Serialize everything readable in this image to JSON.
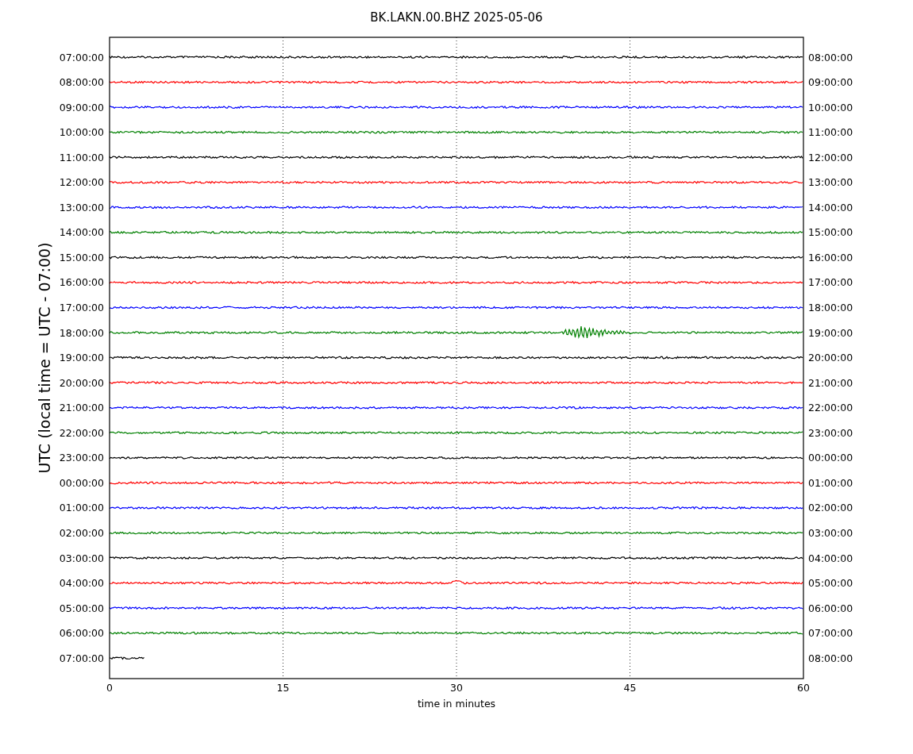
{
  "title": "BK.LAKN.00.BHZ 2025-05-06",
  "y_axis_label": "UTC (local time = UTC - 07:00)",
  "x_axis_label": "time in minutes",
  "x_ticks": [
    "0",
    "15",
    "30",
    "45",
    "60"
  ],
  "traces": [
    {
      "left_label": "07:00:00",
      "right_label": "08:00:00",
      "color": "#000000",
      "kind": "noise"
    },
    {
      "left_label": "08:00:00",
      "right_label": "09:00:00",
      "color": "#ff0000",
      "kind": "noise"
    },
    {
      "left_label": "09:00:00",
      "right_label": "10:00:00",
      "color": "#0000ff",
      "kind": "noise"
    },
    {
      "left_label": "10:00:00",
      "right_label": "11:00:00",
      "color": "#008000",
      "kind": "noise"
    },
    {
      "left_label": "11:00:00",
      "right_label": "12:00:00",
      "color": "#000000",
      "kind": "noise"
    },
    {
      "left_label": "12:00:00",
      "right_label": "13:00:00",
      "color": "#ff0000",
      "kind": "noise"
    },
    {
      "left_label": "13:00:00",
      "right_label": "14:00:00",
      "color": "#0000ff",
      "kind": "noise"
    },
    {
      "left_label": "14:00:00",
      "right_label": "15:00:00",
      "color": "#008000",
      "kind": "noise"
    },
    {
      "left_label": "15:00:00",
      "right_label": "16:00:00",
      "color": "#000000",
      "kind": "noise"
    },
    {
      "left_label": "16:00:00",
      "right_label": "17:00:00",
      "color": "#ff0000",
      "kind": "noise"
    },
    {
      "left_label": "17:00:00",
      "right_label": "18:00:00",
      "color": "#0000ff",
      "kind": "noise"
    },
    {
      "left_label": "18:00:00",
      "right_label": "19:00:00",
      "color": "#008000",
      "kind": "earthquake"
    },
    {
      "left_label": "19:00:00",
      "right_label": "20:00:00",
      "color": "#000000",
      "kind": "noise"
    },
    {
      "left_label": "20:00:00",
      "right_label": "21:00:00",
      "color": "#ff0000",
      "kind": "noise"
    },
    {
      "left_label": "21:00:00",
      "right_label": "22:00:00",
      "color": "#0000ff",
      "kind": "noise"
    },
    {
      "left_label": "22:00:00",
      "right_label": "23:00:00",
      "color": "#008000",
      "kind": "noise"
    },
    {
      "left_label": "23:00:00",
      "right_label": "00:00:00",
      "color": "#000000",
      "kind": "noise"
    },
    {
      "left_label": "00:00:00",
      "right_label": "01:00:00",
      "color": "#ff0000",
      "kind": "noise"
    },
    {
      "left_label": "01:00:00",
      "right_label": "02:00:00",
      "color": "#0000ff",
      "kind": "noise"
    },
    {
      "left_label": "02:00:00",
      "right_label": "03:00:00",
      "color": "#008000",
      "kind": "noise"
    },
    {
      "left_label": "03:00:00",
      "right_label": "04:00:00",
      "color": "#000000",
      "kind": "noise"
    },
    {
      "left_label": "04:00:00",
      "right_label": "05:00:00",
      "color": "#ff0000",
      "kind": "blip"
    },
    {
      "left_label": "05:00:00",
      "right_label": "06:00:00",
      "color": "#0000ff",
      "kind": "noise"
    },
    {
      "left_label": "06:00:00",
      "right_label": "07:00:00",
      "color": "#008000",
      "kind": "noise"
    },
    {
      "left_label": "07:00:00",
      "right_label": "08:00:00",
      "color": "#000000",
      "kind": "partial"
    }
  ]
}
